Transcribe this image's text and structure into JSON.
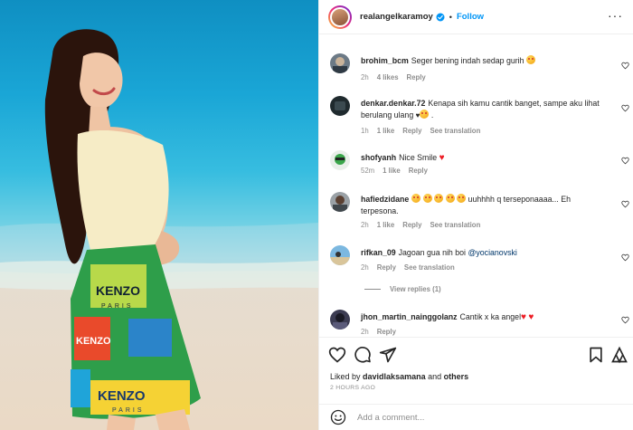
{
  "header": {
    "username": "realangelkaramoy",
    "follow_label": "Follow",
    "separator": "•"
  },
  "comments": [
    {
      "username": "brohim_bcm",
      "text": "Seger bening indah sedap gurih",
      "time": "2h",
      "likes": "4 likes",
      "reply_label": "Reply"
    },
    {
      "username": "denkar.denkar.72",
      "text": "Kenapa sih kamu cantik banget, sampe aku lihat berulang ulang",
      "text_end": ".",
      "time": "1h",
      "likes": "1 like",
      "reply_label": "Reply",
      "translation_label": "See translation"
    },
    {
      "username": "shofyanh",
      "text": "Nice Smile",
      "time": "52m",
      "likes": "1 like",
      "reply_label": "Reply"
    },
    {
      "username": "hafiedzidane",
      "text": "uuhhhh q terseponaaaa... Eh terpesona.",
      "time": "2h",
      "likes": "1 like",
      "reply_label": "Reply",
      "translation_label": "See translation"
    },
    {
      "username": "rifkan_09",
      "text": "Jagoan gua nih boi",
      "mention": "@yocianovski",
      "time": "2h",
      "reply_label": "Reply",
      "translation_label": "See translation",
      "view_replies": "View replies (1)"
    },
    {
      "username": "jhon_martin_nainggolanz",
      "text": "Cantik x ka angel",
      "time": "2h",
      "reply_label": "Reply"
    }
  ],
  "footer": {
    "liked_by_prefix": "Liked by",
    "liked_by_user": "davidlaksamana",
    "liked_by_and": "and",
    "liked_by_others": "others",
    "time_ago": "2 HOURS AGO",
    "comment_placeholder": "Add a comment..."
  },
  "photo": {
    "skirt_text_top": "KENZO",
    "skirt_text_sub": "PARIS",
    "skirt_text_left": "KENZO",
    "skirt_text_bottom": "KENZO",
    "skirt_text_bottom_sub": "PARIS"
  },
  "colors": {
    "accent_link": "#0095f6",
    "verified": "#0095f6",
    "muted_text": "#8e8e8e",
    "red_heart": "#ed1c24"
  }
}
